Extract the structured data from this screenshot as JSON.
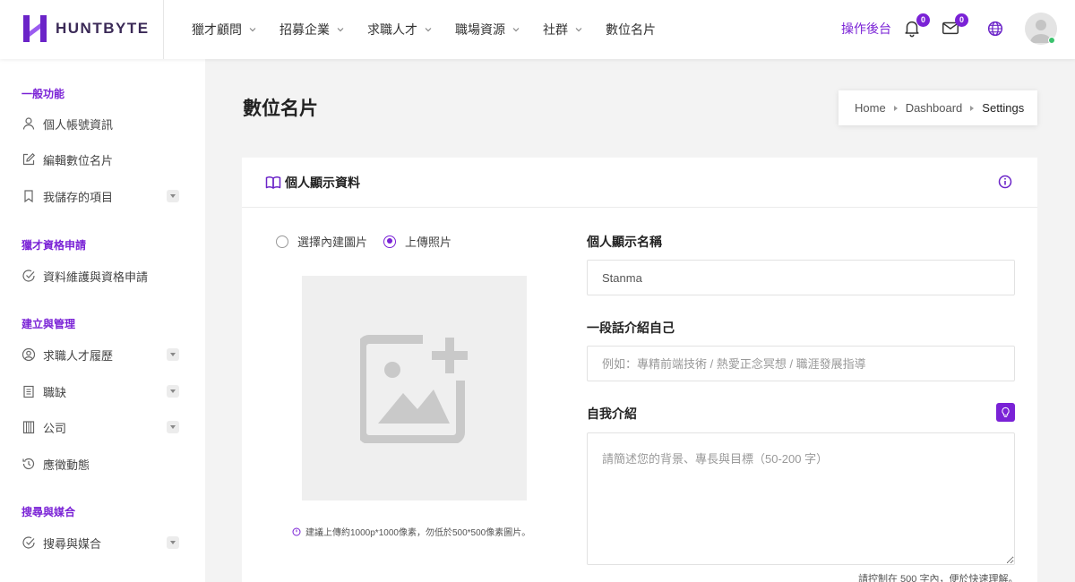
{
  "brand": {
    "name": "HUNTBYTE",
    "color": "#7a22d6"
  },
  "nav": {
    "items": [
      {
        "label": "獵才顧問",
        "dropdown": true
      },
      {
        "label": "招募企業",
        "dropdown": true
      },
      {
        "label": "求職人才",
        "dropdown": true
      },
      {
        "label": "職場資源",
        "dropdown": true
      },
      {
        "label": "社群",
        "dropdown": true
      },
      {
        "label": "數位名片",
        "dropdown": false
      }
    ],
    "admin_label": "操作後台",
    "notifications_count": "0",
    "messages_count": "0"
  },
  "sidebar": {
    "sections": [
      {
        "title": "一般功能",
        "items": [
          {
            "label": "個人帳號資訊",
            "icon": "user-icon"
          },
          {
            "label": "編輯數位名片",
            "icon": "edit-icon"
          },
          {
            "label": "我儲存的項目",
            "icon": "bookmark-icon",
            "dropdown": true
          }
        ]
      },
      {
        "title": "獵才資格申請",
        "items": [
          {
            "label": "資料維護與資格申請",
            "icon": "check-circle-icon"
          }
        ]
      },
      {
        "title": "建立與管理",
        "items": [
          {
            "label": "求職人才履歷",
            "icon": "user-circle-icon",
            "dropdown": true
          },
          {
            "label": "職缺",
            "icon": "clipboard-icon",
            "dropdown": true
          },
          {
            "label": "公司",
            "icon": "building-icon",
            "dropdown": true
          },
          {
            "label": "應徵動態",
            "icon": "history-icon"
          }
        ]
      },
      {
        "title": "搜尋與媒合",
        "items": [
          {
            "label": "搜尋與媒合",
            "icon": "check-circle-icon",
            "dropdown": true
          }
        ]
      }
    ]
  },
  "page": {
    "title": "數位名片",
    "breadcrumb": [
      "Home",
      "Dashboard",
      "Settings"
    ]
  },
  "card": {
    "title": "個人顯示資料",
    "photo_options": [
      {
        "label": "選擇內建圖片",
        "selected": false
      },
      {
        "label": "上傳照片",
        "selected": true
      }
    ],
    "image_hint": "建議上傳約1000p*1000像素，勿低於500*500像素圖片。",
    "display_name": {
      "label": "個人顯示名稱",
      "value": "Stanma"
    },
    "tagline": {
      "label": "一段話介紹自己",
      "placeholder": "例如：專精前端技術 / 熱愛正念冥想 / 職涯發展指導"
    },
    "bio": {
      "label": "自我介紹",
      "placeholder": "請簡述您的背景、專長與目標（50-200 字）",
      "hint": "請控制在 500 字內，便於快速理解。"
    }
  }
}
